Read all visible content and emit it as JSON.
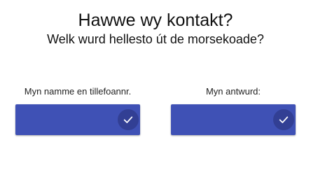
{
  "header": {
    "title": "Hawwe wy kontakt?",
    "subtitle": "Welk wurd hellesto út de morsekoade?"
  },
  "fields": [
    {
      "label": "Myn namme en tillefoannr.",
      "value": "",
      "icon": "check-icon"
    },
    {
      "label": "Myn antwurd:",
      "value": "",
      "icon": "check-icon"
    }
  ],
  "colors": {
    "accent": "#3f51b5",
    "icon": "#ffffff",
    "text": "#111111"
  }
}
